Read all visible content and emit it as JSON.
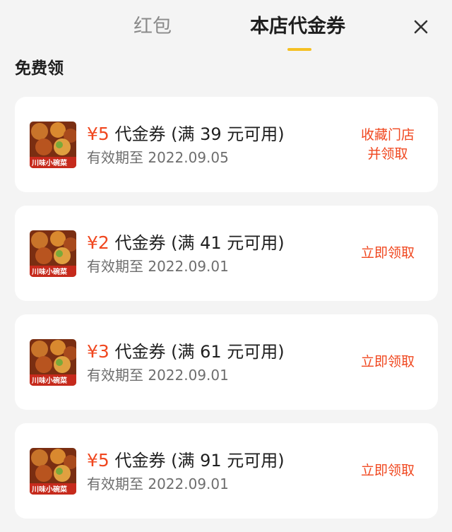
{
  "header": {
    "tabs": [
      {
        "label": "红包",
        "active": false
      },
      {
        "label": "本店代金券",
        "active": true
      }
    ],
    "close_icon": "close-icon",
    "accent_color": "#f5c023"
  },
  "section": {
    "title": "免费领"
  },
  "coupons": [
    {
      "price": "¥5",
      "title": "代金券 (满 39 元可用)",
      "expiry": "有效期至 2022.09.05",
      "action": [
        "收藏门店",
        "并领取"
      ],
      "thumb_label": "川味小碗菜"
    },
    {
      "price": "¥2",
      "title": "代金券 (满 41 元可用)",
      "expiry": "有效期至 2022.09.01",
      "action": [
        "立即领取"
      ],
      "thumb_label": "川味小碗菜"
    },
    {
      "price": "¥3",
      "title": "代金券 (满 61 元可用)",
      "expiry": "有效期至 2022.09.01",
      "action": [
        "立即领取"
      ],
      "thumb_label": "川味小碗菜"
    },
    {
      "price": "¥5",
      "title": "代金券 (满 91 元可用)",
      "expiry": "有效期至 2022.09.01",
      "action": [
        "立即领取"
      ],
      "thumb_label": "川味小碗菜"
    }
  ],
  "colors": {
    "price": "#f0471f",
    "action": "#f0471f",
    "card_bg": "#ffffff",
    "page_bg": "#f4f4f4"
  }
}
